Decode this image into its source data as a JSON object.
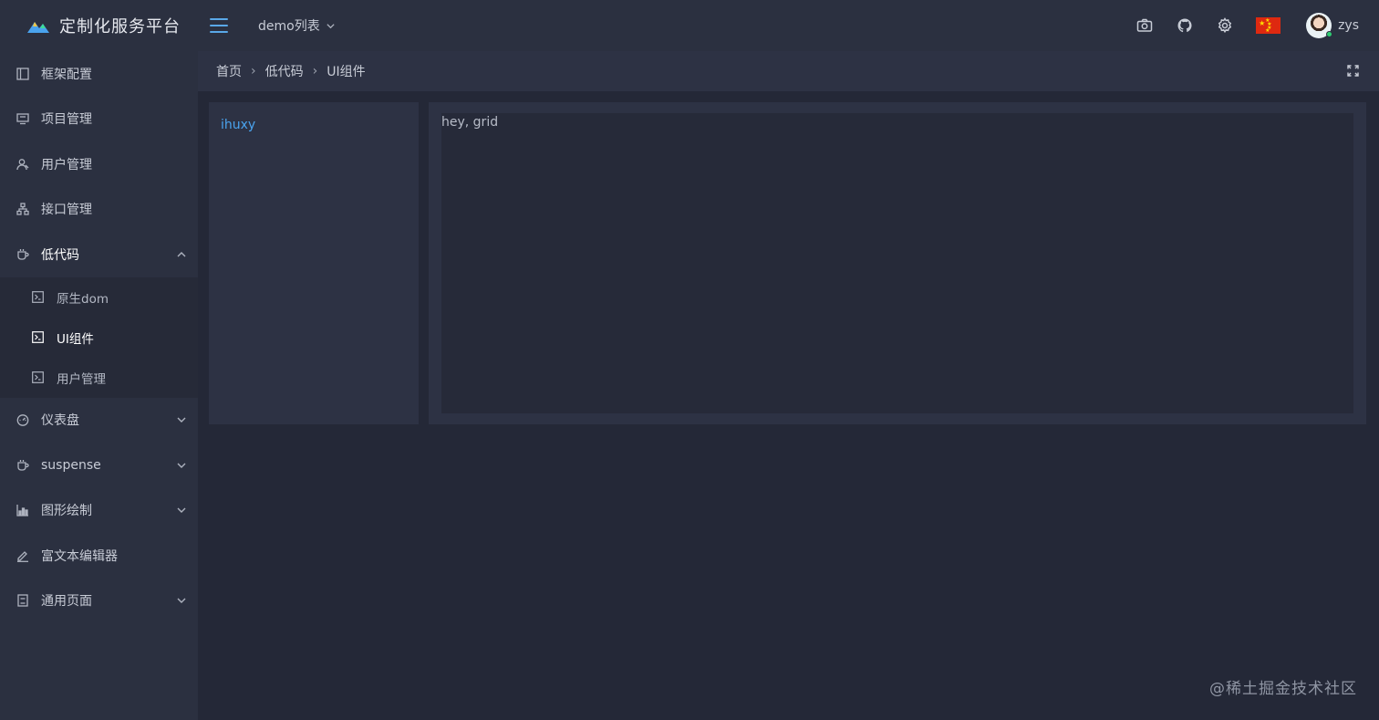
{
  "brand": {
    "title": "定制化服务平台",
    "logo_icon": "mountain-logo-icon"
  },
  "sidebar": {
    "items": [
      {
        "label": "框架配置",
        "icon": "layout-icon"
      },
      {
        "label": "项目管理",
        "icon": "monitor-icon"
      },
      {
        "label": "用户管理",
        "icon": "users-icon"
      },
      {
        "label": "接口管理",
        "icon": "network-icon"
      },
      {
        "label": "低代码",
        "icon": "cup-icon",
        "expanded": true,
        "children": [
          {
            "label": "原生dom",
            "icon": "terminal-icon"
          },
          {
            "label": "UI组件",
            "icon": "terminal-icon",
            "active": true
          },
          {
            "label": "用户管理",
            "icon": "terminal-icon"
          }
        ]
      },
      {
        "label": "仪表盘",
        "icon": "gauge-icon"
      },
      {
        "label": "suspense",
        "icon": "cup-icon"
      },
      {
        "label": "图形绘制",
        "icon": "chart-icon"
      },
      {
        "label": "富文本编辑器",
        "icon": "pen-icon"
      },
      {
        "label": "通用页面",
        "icon": "page-icon"
      }
    ]
  },
  "header": {
    "demo_select": "demo列表",
    "username": "zys",
    "accent": "#5aa8e8"
  },
  "breadcrumb": {
    "items": [
      "首页",
      "低代码",
      "UI组件"
    ],
    "separator": "›"
  },
  "content": {
    "link_text": "ihuxy",
    "grid_text": "hey, grid"
  },
  "watermark": "@稀土掘金技术社区"
}
